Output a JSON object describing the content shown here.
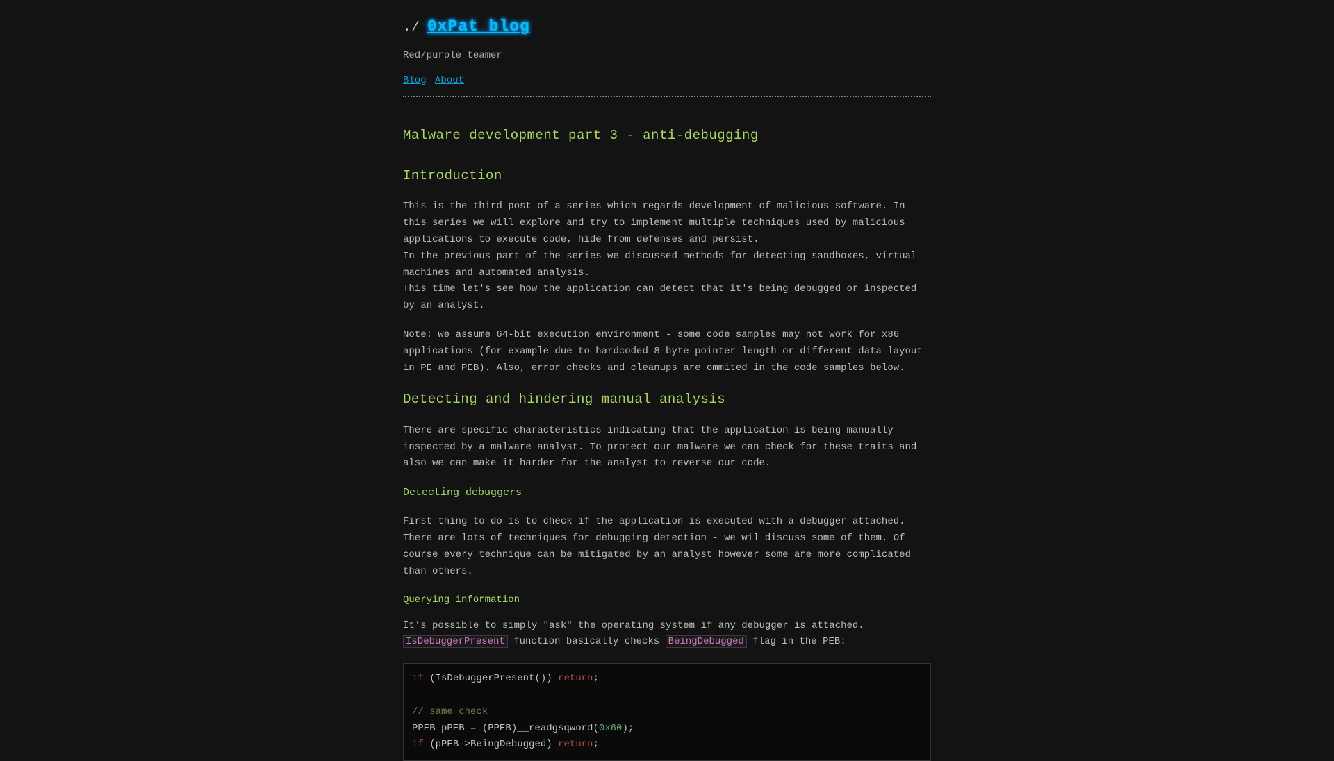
{
  "header": {
    "prompt": "./",
    "site_title": "0xPat blog",
    "subtitle": "Red/purple teamer",
    "nav": {
      "blog": "Blog",
      "about": "About"
    }
  },
  "article": {
    "title": "Malware development part 3 - anti-debugging",
    "sections": {
      "intro": {
        "heading": "Introduction",
        "p1": "This is the third post of a series which regards development of malicious software. In this series we will explore and try to implement multiple techniques used by malicious applications to execute code, hide from defenses and persist.",
        "p2": "In the previous part of the series we discussed methods for detecting sandboxes, virtual machines and automated analysis.",
        "p3": "This time let's see how the application can detect that it's being debugged or inspected by an analyst.",
        "note": "Note: we assume 64-bit execution environment - some code samples may not work for x86 applications (for example due to hardcoded 8-byte pointer length or different data layout in PE and PEB). Also, error checks and cleanups are ommited in the code samples below."
      },
      "detect": {
        "heading": "Detecting and hindering manual analysis",
        "p1": "There are specific characteristics indicating that the application is being manually inspected by a malware analyst. To protect our malware we can check for these traits and also we can make it harder for the analyst to reverse our code."
      },
      "detectdbg": {
        "heading": "Detecting debuggers",
        "p1": "First thing to do is to check if the application is executed with a debugger attached. There are lots of techniques for debugging detection - we wil discuss some of them. Of course every technique can be mitigated by an analyst however some are more complicated than others."
      },
      "queryinfo": {
        "heading": "Querying information",
        "p1_pre": "It's possible to simply \"ask\" the operating system if any debugger is attached. ",
        "code1": "IsDebuggerPresent",
        "p1_mid": " function basically checks ",
        "code2": "BeingDebugged",
        "p1_post": " flag in the PEB:"
      }
    },
    "code": {
      "kw_if1": "if",
      "line1_rest": " (IsDebuggerPresent()) ",
      "ret1": "return",
      "semi1": ";",
      "blank": "",
      "cmt": "// same check",
      "line3_a": "PPEB pPEB = (PPEB)__readgsqword(",
      "num1": "0x60",
      "line3_b": ");",
      "kw_if2": "if",
      "line4_rest": " (pPEB->BeingDebugged) ",
      "ret2": "return",
      "semi2": ";"
    }
  }
}
